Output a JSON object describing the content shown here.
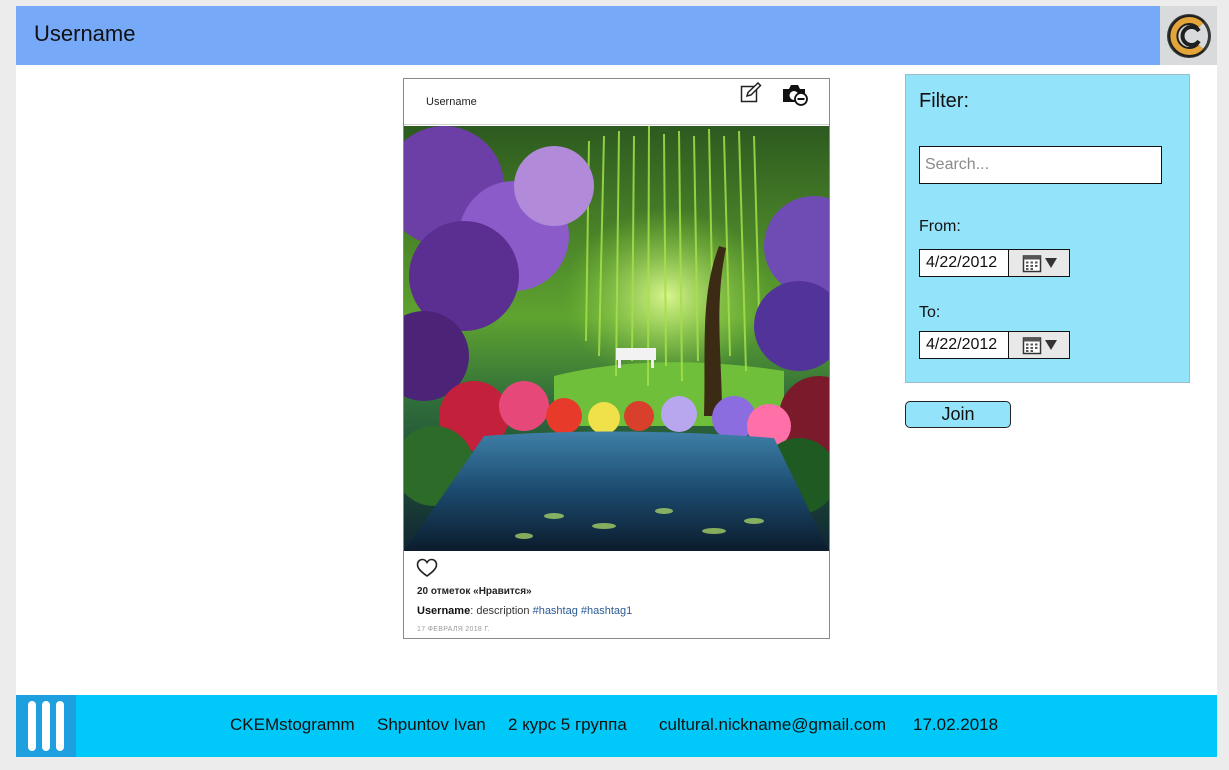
{
  "header": {
    "title": "Username",
    "logo_icon": "c-logo-icon"
  },
  "post": {
    "username": "Username",
    "likes": "20 отметок «Нравится»",
    "caption_user": "Username",
    "caption_sep": ":",
    "caption_text": " description ",
    "hashtags": [
      "#hashtag",
      "#hashtag1"
    ],
    "date": "17 ФЕВРАЛЯ 2018 Г.",
    "icons": [
      "edit-icon",
      "camera-icon",
      "heart-icon"
    ]
  },
  "filter": {
    "title": "Filter:",
    "search_placeholder": "Search...",
    "from_label": "From:",
    "from_value": "4/22/2012",
    "to_label": "To:",
    "to_value": "4/22/2012"
  },
  "join_label": "Join",
  "footer": {
    "app": "CKEMstogramm",
    "author": "Shpuntov Ivan",
    "group": "2 курс 5 группа",
    "email": "cultural.nickname@gmail.com",
    "date": "17.02.2018"
  },
  "colors": {
    "header": "#76aaf8",
    "filter": "#93e3fb",
    "footer": "#00c8f8",
    "menu": "#1d9fe0"
  }
}
